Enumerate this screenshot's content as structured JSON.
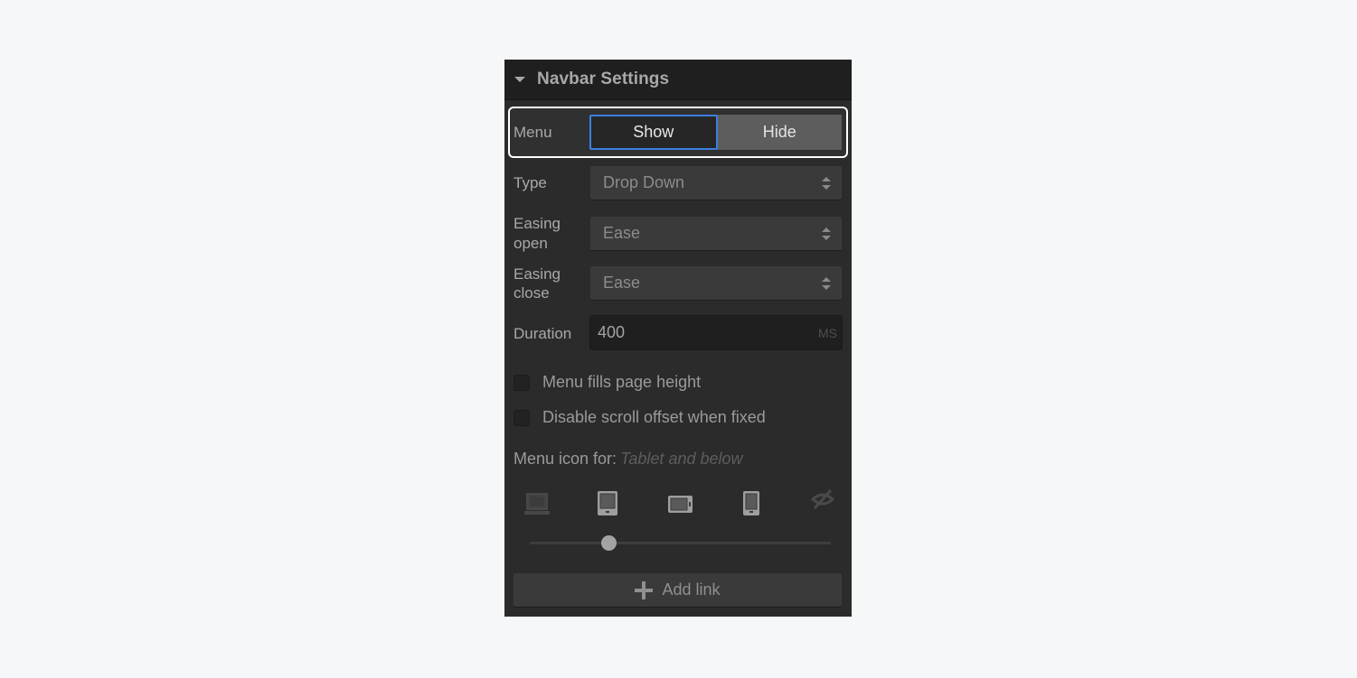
{
  "panel": {
    "title": "Navbar Settings",
    "menu": {
      "label": "Menu",
      "options": [
        "Show",
        "Hide"
      ],
      "selected": "Show"
    },
    "type": {
      "label": "Type",
      "value": "Drop Down"
    },
    "easing_open": {
      "label": "Easing open",
      "label_line1": "Easing",
      "label_line2": "open",
      "value": "Ease"
    },
    "easing_close": {
      "label": "Easing close",
      "label_line1": "Easing",
      "label_line2": "close",
      "value": "Ease"
    },
    "duration": {
      "label": "Duration",
      "value": "400",
      "unit": "MS"
    },
    "checkboxes": [
      {
        "label": "Menu fills page height",
        "checked": false
      },
      {
        "label": "Disable scroll offset when fixed",
        "checked": false
      }
    ],
    "menu_icon": {
      "label": "Menu icon for:",
      "value": "Tablet and below",
      "devices": [
        "desktop",
        "tablet",
        "mobile-landscape",
        "mobile-portrait",
        "none"
      ],
      "selected_index": 1,
      "slider_fraction": 0.26
    },
    "add_link_label": "Add link"
  }
}
